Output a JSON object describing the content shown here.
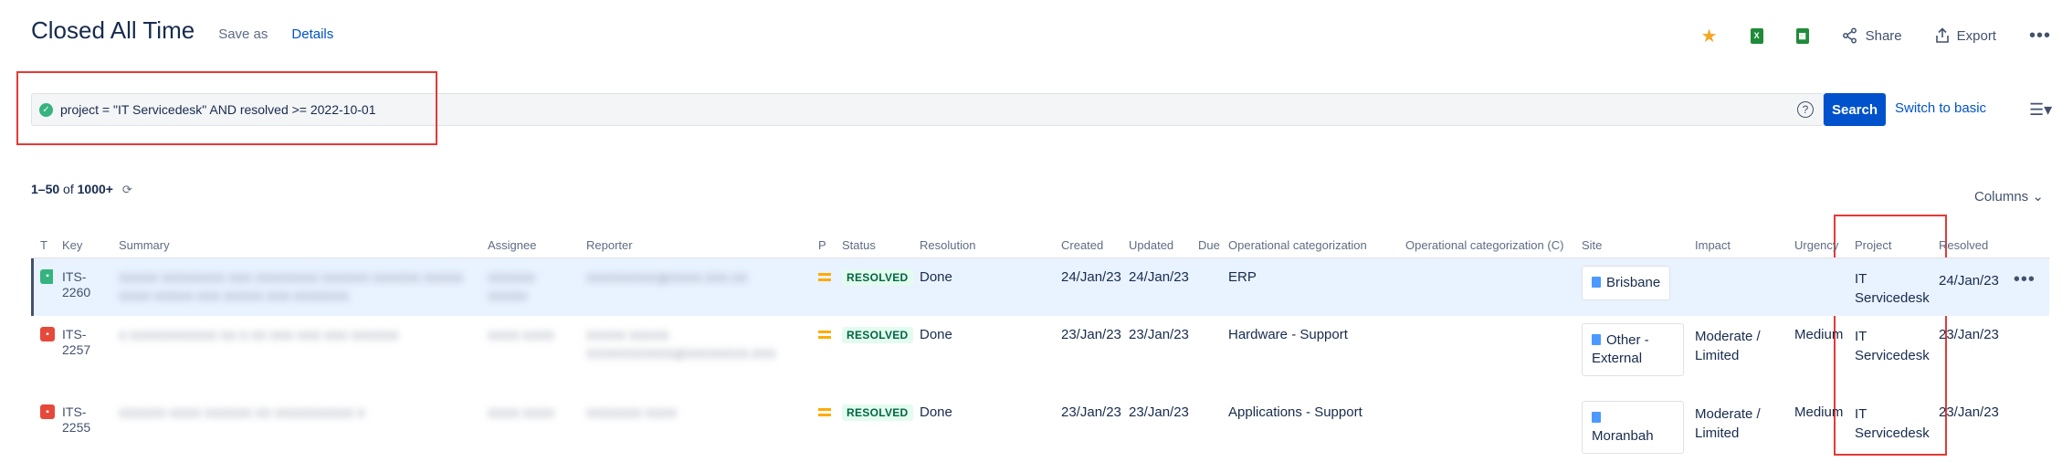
{
  "header": {
    "title": "Closed All Time",
    "save_as": "Save as",
    "details": "Details"
  },
  "toolbar": {
    "share": "Share",
    "export": "Export",
    "excel_glyph": "X",
    "sheet_glyph": "▦"
  },
  "search": {
    "jql": "project = \"IT Servicedesk\" AND resolved >= 2022-10-01",
    "search_label": "Search",
    "switch_label": "Switch to basic"
  },
  "results": {
    "range": "1–50",
    "of": "of",
    "total": "1000+",
    "columns_label": "Columns"
  },
  "table": {
    "headers": [
      "T",
      "Key",
      "Summary",
      "Assignee",
      "Reporter",
      "P",
      "Status",
      "Resolution",
      "Created",
      "Updated",
      "Due",
      "Operational categorization",
      "Operational categorization (C)",
      "Site",
      "Impact",
      "Urgency",
      "Project",
      "Resolved"
    ],
    "rows": [
      {
        "type": "service-request",
        "key": "ITS-2260",
        "summary": "XXXXX XXXXXXXX XXX XXXXXXXX XXXXXX XXXXXX XXXXX XXXX XXXXX XXX XXXXX XXX XXXXXXX",
        "assignee": "XXXXXX XXXXX",
        "reporter": "XXXXXXXXX@XXXX.XXX.XX",
        "status": "RESOLVED",
        "resolution": "Done",
        "created": "24/Jan/23",
        "updated": "24/Jan/23",
        "due": "",
        "opcat": "ERP",
        "opcat_c": "",
        "site": "Brisbane",
        "impact": "",
        "urgency": "",
        "project": "IT Servicedesk",
        "resolved": "24/Jan/23"
      },
      {
        "type": "incident",
        "key": "ITS-2257",
        "summary": "X XXXXXXXXXXX XX X XX XXX XXX XXX XXXXXX",
        "assignee": "XXXX XXXX",
        "reporter": "XXXXX XXXXX XXXXXXXXXXX@XXXXXXXX.XXX",
        "status": "RESOLVED",
        "resolution": "Done",
        "created": "23/Jan/23",
        "updated": "23/Jan/23",
        "due": "",
        "opcat": "Hardware - Support",
        "opcat_c": "",
        "site": "Other - External",
        "impact": "Moderate / Limited",
        "urgency": "Medium",
        "project": "IT Servicedesk",
        "resolved": "23/Jan/23"
      },
      {
        "type": "incident",
        "key": "ITS-2255",
        "summary": "XXXXXX XXXX XXXXXX XX XXXXXXXXXX X",
        "assignee": "XXXX XXXX",
        "reporter": "XXXXXXX XXXX",
        "status": "RESOLVED",
        "resolution": "Done",
        "created": "23/Jan/23",
        "updated": "23/Jan/23",
        "due": "",
        "opcat": "Applications - Support",
        "opcat_c": "",
        "site": "Moranbah",
        "impact": "Moderate / Limited",
        "urgency": "Medium",
        "project": "IT Servicedesk",
        "resolved": "23/Jan/23"
      }
    ]
  },
  "colors": {
    "accent": "#0052cc",
    "highlight_box": "#e53935",
    "resolved_lozenge": "#e3fcef",
    "selected_row": "#e9f2ff"
  }
}
